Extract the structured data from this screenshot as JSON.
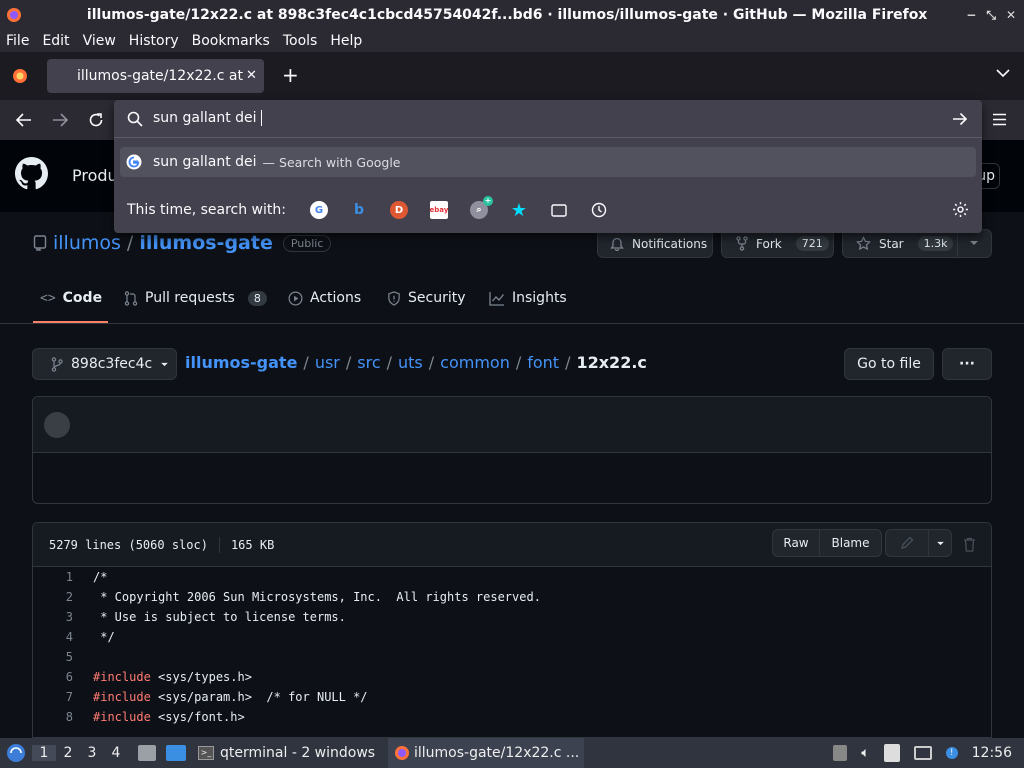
{
  "window": {
    "title": "illumos-gate/12x22.c at 898c3fec4c1cbcd45754042f...bd6 · illumos/illumos-gate · GitHub — Mozilla Firefox"
  },
  "menu": [
    "File",
    "Edit",
    "View",
    "History",
    "Bookmarks",
    "Tools",
    "Help"
  ],
  "tab": {
    "label": "illumos-gate/12x22.c at"
  },
  "urlbar": {
    "value": "sun gallant dei",
    "suggestion": "sun gallant dei",
    "suggestion_sub": "— Search with Google",
    "search_with": "This time, search with:"
  },
  "gh": {
    "product": "Produ",
    "signup": "up",
    "owner": "illumos",
    "sep": "/",
    "repo": "illumos-gate",
    "visibility": "Public",
    "notifications": "Notifications",
    "fork": "Fork",
    "fork_count": "721",
    "star": "Star",
    "star_count": "1.3k",
    "tabs": [
      {
        "label": "Code"
      },
      {
        "label": "Pull requests",
        "count": "8"
      },
      {
        "label": "Actions"
      },
      {
        "label": "Security"
      },
      {
        "label": "Insights"
      }
    ],
    "branch": "898c3fec4c",
    "path": [
      "illumos-gate",
      "usr",
      "src",
      "uts",
      "common",
      "font"
    ],
    "file": "12x22.c",
    "goto": "Go to file",
    "more": "···",
    "file_info": "5279 lines (5060 sloc)",
    "file_size": "165 KB",
    "raw": "Raw",
    "blame": "Blame",
    "code": [
      {
        "n": "1",
        "t": "/*"
      },
      {
        "n": "2",
        "t": " * Copyright 2006 Sun Microsystems, Inc.  All rights reserved."
      },
      {
        "n": "3",
        "t": " * Use is subject to license terms."
      },
      {
        "n": "4",
        "t": " */"
      },
      {
        "n": "5",
        "t": ""
      },
      {
        "n": "6",
        "kw": "#include",
        "t": " <sys/types.h>"
      },
      {
        "n": "7",
        "kw": "#include",
        "t": " <sys/param.h>  /* for NULL */"
      },
      {
        "n": "8",
        "kw": "#include",
        "t": " <sys/font.h>"
      }
    ]
  },
  "taskbar": {
    "workspaces": [
      "1",
      "2",
      "3",
      "4"
    ],
    "terminal": "qterminal - 2 windows",
    "firefox": "illumos-gate/12x22.c ...",
    "clock": "12:56"
  },
  "colors": {
    "link": "#4493f8",
    "accent": "#f78166",
    "keyword": "#ff7b72"
  }
}
